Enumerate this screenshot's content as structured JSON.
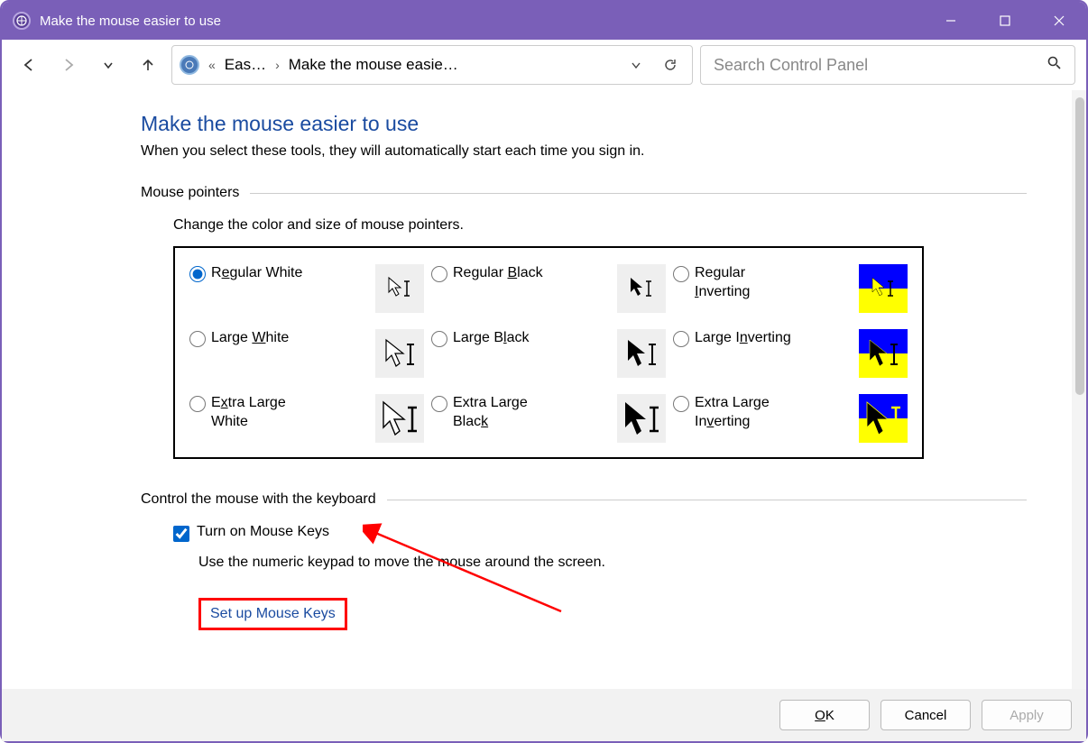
{
  "window": {
    "title": "Make the mouse easier to use"
  },
  "breadcrumb": {
    "level1": "Eas…",
    "level2": "Make the mouse easie…"
  },
  "search": {
    "placeholder": "Search Control Panel"
  },
  "page": {
    "heading": "Make the mouse easier to use",
    "subheading": "When you select these tools, they will automatically start each time you sign in."
  },
  "mousePointers": {
    "section_label": "Mouse pointers",
    "description": "Change the color and size of mouse pointers.",
    "options": {
      "regular_white_pre": "R",
      "regular_white_u": "e",
      "regular_white_post": "gular White",
      "large_white_pre": "Large ",
      "large_white_u": "W",
      "large_white_post": "hite",
      "extra_white_pre": "E",
      "extra_white_u": "x",
      "extra_white_post": "tra Large White",
      "regular_black_pre": "Regular ",
      "regular_black_u": "B",
      "regular_black_post": "lack",
      "large_black_pre": "Large B",
      "large_black_u": "l",
      "large_black_post": "ack",
      "extra_black_pre": "Extra Large Blac",
      "extra_black_u": "k",
      "extra_black_post": "",
      "regular_inv_pre": "Regular ",
      "regular_inv_u": "I",
      "regular_inv_post": "nverting",
      "large_inv_pre": "Large I",
      "large_inv_u": "n",
      "large_inv_post": "verting",
      "extra_inv_pre": "Extra Large In",
      "extra_inv_u": "v",
      "extra_inv_post": "erting"
    }
  },
  "keyboardControl": {
    "section_label": "Control the mouse with the keyboard",
    "checkbox_pre": "Turn on ",
    "checkbox_u": "M",
    "checkbox_post": "ouse Keys",
    "description": "Use the numeric keypad to move the mouse around the screen.",
    "link": "Set up Mouse Keys"
  },
  "buttons": {
    "ok_u": "O",
    "ok_post": "K",
    "cancel": "Cancel",
    "apply": "Apply"
  }
}
